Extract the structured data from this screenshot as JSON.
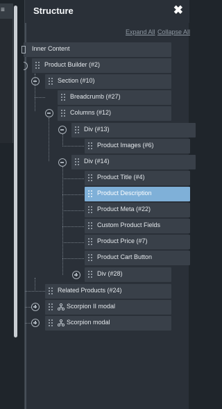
{
  "panel": {
    "title": "Structure",
    "close_glyph": "✖",
    "expand_all": "Expand All",
    "collapse_all": "Collapse All"
  },
  "left_panel": {
    "tab_glyph": "≡"
  },
  "tree": {
    "inner_content": "Inner Content",
    "product_builder": "Product Builder (#2)",
    "section": "Section (#10)",
    "breadcrumb": "Breadcrumb (#27)",
    "columns": "Columns (#12)",
    "div13": "Div (#13)",
    "product_images": "Product Images (#6)",
    "div14": "Div (#14)",
    "product_title": "Product Title (#4)",
    "product_description": "Product Description",
    "product_meta": "Product Meta (#22)",
    "custom_product_fields": "Custom Product Fields",
    "product_price": "Product Price (#7)",
    "product_cart_button": "Product Cart Button",
    "div28": "Div (#28)",
    "related_products": "Related Products (#24)",
    "scorpion_ii_modal": "Scorpion II modal",
    "scorpion_modal": "Scorpion modal"
  },
  "colors": {
    "panel_bg": "#2a3038",
    "node_bg": "#394049",
    "selected": "#7fb0d8"
  },
  "icons": [
    "close-icon",
    "drag-handle-icon",
    "collapse-icon",
    "expand-icon",
    "component-icon",
    "document-icon"
  ]
}
